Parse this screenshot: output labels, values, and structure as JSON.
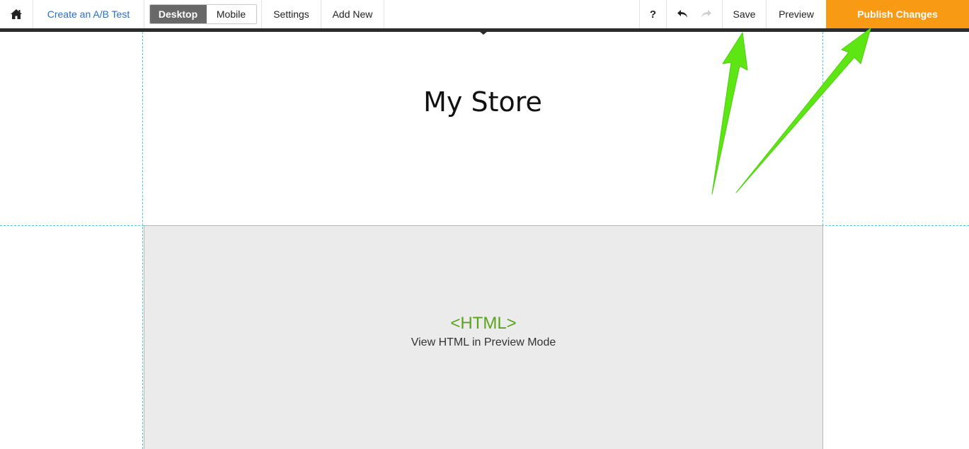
{
  "toolbar": {
    "home_icon": "home-icon",
    "ab_test_label": "Create an A/B Test",
    "device_desktop_label": "Desktop",
    "device_mobile_label": "Mobile",
    "settings_label": "Settings",
    "add_new_label": "Add New",
    "help_label": "?",
    "undo_icon": "undo-icon",
    "redo_icon": "redo-icon",
    "save_label": "Save",
    "preview_label": "Preview",
    "publish_label": "Publish Changes",
    "publish_color": "#f99a14",
    "link_color": "#2a6fc0"
  },
  "canvas": {
    "store_title": "My Store",
    "html_block": {
      "tag_label": "<HTML>",
      "caption": "View HTML in Preview Mode",
      "tag_color": "#5aa31c"
    },
    "guide_color": "#4fc6de"
  },
  "annotation": {
    "arrow_color": "#5ee614"
  }
}
